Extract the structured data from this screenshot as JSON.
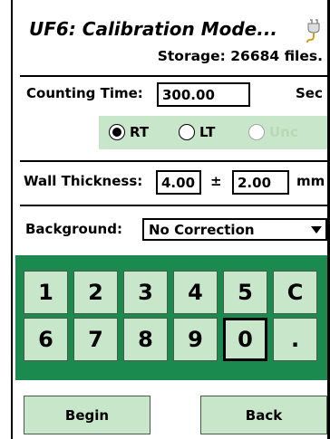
{
  "header": {
    "title": "UF6: Calibration Mode...",
    "storage_text": "Storage: 26684 files.",
    "power_icon": "power-plug-icon"
  },
  "counting": {
    "label": "Counting Time:",
    "value": "300.00",
    "unit": "Sec"
  },
  "mode": {
    "options": [
      {
        "label": "RT",
        "selected": true,
        "enabled": true
      },
      {
        "label": "LT",
        "selected": false,
        "enabled": true
      },
      {
        "label": "Unc",
        "selected": false,
        "enabled": false
      }
    ]
  },
  "wall": {
    "label": "Wall Thickness:",
    "value": "4.00",
    "plusminus": "±",
    "tolerance": "2.00",
    "unit": "mm"
  },
  "background": {
    "label": "Background:",
    "selected": "No Correction"
  },
  "keypad": {
    "row1": [
      "1",
      "2",
      "3",
      "4",
      "5",
      "C"
    ],
    "row2": [
      "6",
      "7",
      "8",
      "9",
      "0",
      "."
    ],
    "focused_key": "0"
  },
  "actions": {
    "begin_label": "Begin",
    "back_label": "Back"
  },
  "colors": {
    "keypad_bg": "#1b8a4f",
    "button_bg": "#c8e6c9"
  }
}
